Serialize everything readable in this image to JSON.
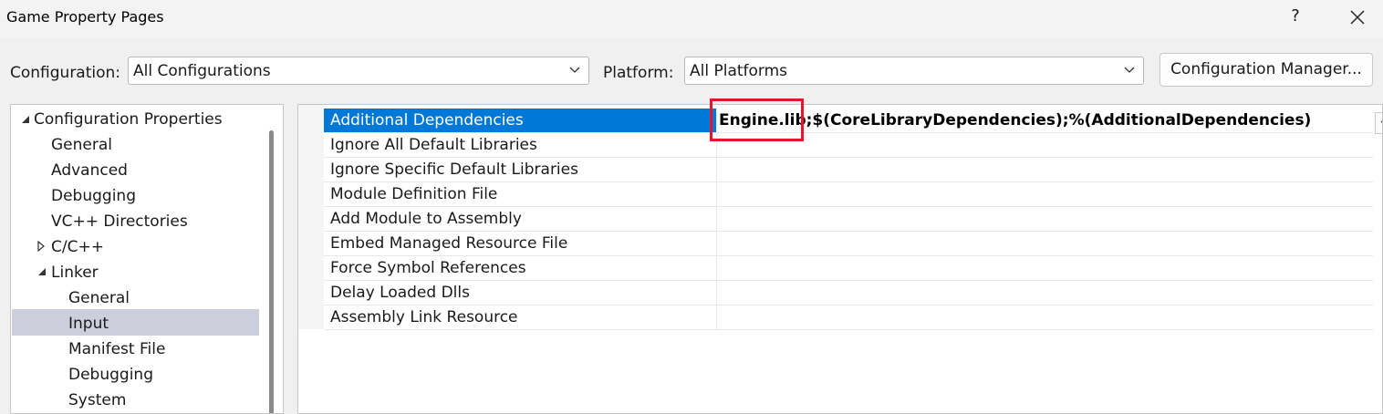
{
  "window": {
    "title": "Game Property Pages",
    "help_label": "?"
  },
  "config": {
    "configuration_label": "Configuration:",
    "configuration_value": "All Configurations",
    "platform_label": "Platform:",
    "platform_value": "All Platforms",
    "manager_button": "Configuration Manager..."
  },
  "tree": {
    "root": "Configuration Properties",
    "items": [
      "General",
      "Advanced",
      "Debugging",
      "VC++ Directories",
      "C/C++",
      "Linker"
    ],
    "linker_children": [
      "General",
      "Input",
      "Manifest File",
      "Debugging",
      "System"
    ],
    "selected": "Input"
  },
  "grid": {
    "rows": [
      "Additional Dependencies",
      "Ignore All Default Libraries",
      "Ignore Specific Default Libraries",
      "Module Definition File",
      "Add Module to Assembly",
      "Embed Managed Resource File",
      "Force Symbol References",
      "Delay Loaded Dlls",
      "Assembly Link Resource"
    ],
    "selected_value": "Engine.lib;$(CoreLibraryDependencies);%(AdditionalDependencies)"
  },
  "colors": {
    "selection": "#0078d7",
    "tree_selection": "#cccedb",
    "highlight": "#e2172f"
  }
}
